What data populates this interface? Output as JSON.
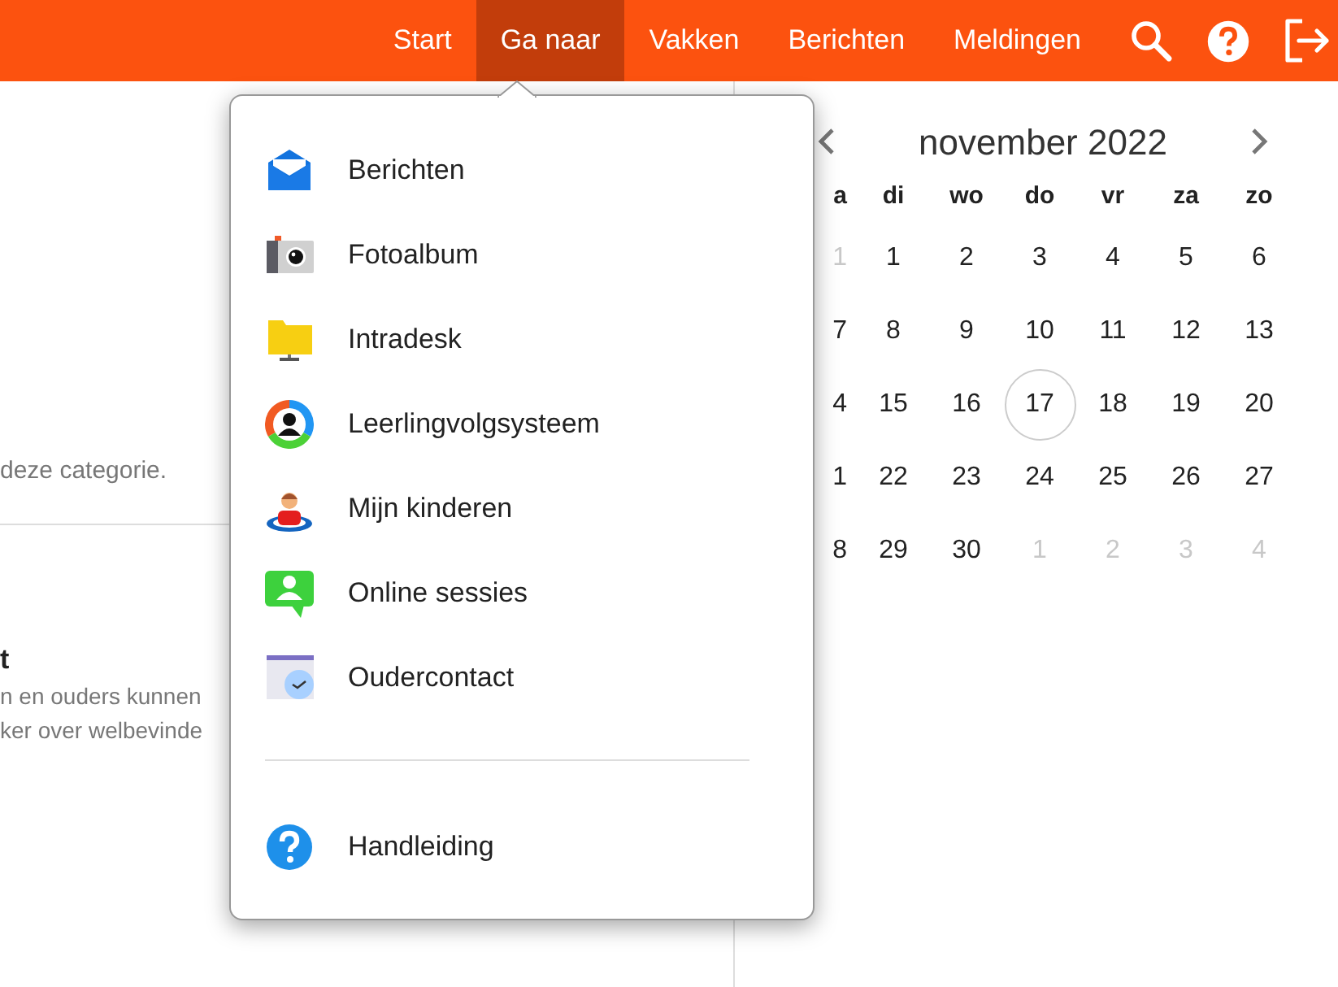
{
  "nav": {
    "items": [
      {
        "label": "Start",
        "selected": false
      },
      {
        "label": "Ga naar",
        "selected": true
      },
      {
        "label": "Vakken",
        "selected": false
      },
      {
        "label": "Berichten",
        "selected": false
      },
      {
        "label": "Meldingen",
        "selected": false
      }
    ]
  },
  "left_panel": {
    "note": "deze categorie.",
    "title": "t",
    "description_lines": [
      "n en ouders kunnen",
      "ker over welbevinde"
    ]
  },
  "menu": {
    "items": [
      {
        "kind": "envelope",
        "label": "Berichten"
      },
      {
        "kind": "camera",
        "label": "Fotoalbum"
      },
      {
        "kind": "folder",
        "label": "Intradesk"
      },
      {
        "kind": "student",
        "label": "Leerlingvolgsysteem"
      },
      {
        "kind": "child",
        "label": "Mijn kinderen"
      },
      {
        "kind": "session",
        "label": "Online sessies"
      },
      {
        "kind": "calendar",
        "label": "Oudercontact"
      }
    ],
    "footer": [
      {
        "kind": "help",
        "label": "Handleiding"
      }
    ]
  },
  "calendar": {
    "title": "november 2022",
    "weekdays": [
      "a",
      "di",
      "wo",
      "do",
      "vr",
      "za",
      "zo"
    ],
    "weeks": [
      [
        {
          "label": "1",
          "outside": true,
          "today": false
        },
        {
          "label": "1",
          "outside": false,
          "today": false
        },
        {
          "label": "2",
          "outside": false,
          "today": false
        },
        {
          "label": "3",
          "outside": false,
          "today": false
        },
        {
          "label": "4",
          "outside": false,
          "today": false
        },
        {
          "label": "5",
          "outside": false,
          "today": false
        },
        {
          "label": "6",
          "outside": false,
          "today": false
        }
      ],
      [
        {
          "label": "7",
          "outside": false,
          "today": false
        },
        {
          "label": "8",
          "outside": false,
          "today": false
        },
        {
          "label": "9",
          "outside": false,
          "today": false
        },
        {
          "label": "10",
          "outside": false,
          "today": false
        },
        {
          "label": "11",
          "outside": false,
          "today": false
        },
        {
          "label": "12",
          "outside": false,
          "today": false
        },
        {
          "label": "13",
          "outside": false,
          "today": false
        }
      ],
      [
        {
          "label": "4",
          "outside": false,
          "today": false
        },
        {
          "label": "15",
          "outside": false,
          "today": false
        },
        {
          "label": "16",
          "outside": false,
          "today": false
        },
        {
          "label": "17",
          "outside": false,
          "today": true
        },
        {
          "label": "18",
          "outside": false,
          "today": false
        },
        {
          "label": "19",
          "outside": false,
          "today": false
        },
        {
          "label": "20",
          "outside": false,
          "today": false
        }
      ],
      [
        {
          "label": "1",
          "outside": false,
          "today": false
        },
        {
          "label": "22",
          "outside": false,
          "today": false
        },
        {
          "label": "23",
          "outside": false,
          "today": false
        },
        {
          "label": "24",
          "outside": false,
          "today": false
        },
        {
          "label": "25",
          "outside": false,
          "today": false
        },
        {
          "label": "26",
          "outside": false,
          "today": false
        },
        {
          "label": "27",
          "outside": false,
          "today": false
        }
      ],
      [
        {
          "label": "8",
          "outside": false,
          "today": false
        },
        {
          "label": "29",
          "outside": false,
          "today": false
        },
        {
          "label": "30",
          "outside": false,
          "today": false
        },
        {
          "label": "1",
          "outside": true,
          "today": false
        },
        {
          "label": "2",
          "outside": true,
          "today": false
        },
        {
          "label": "3",
          "outside": true,
          "today": false
        },
        {
          "label": "4",
          "outside": true,
          "today": false
        }
      ]
    ]
  }
}
